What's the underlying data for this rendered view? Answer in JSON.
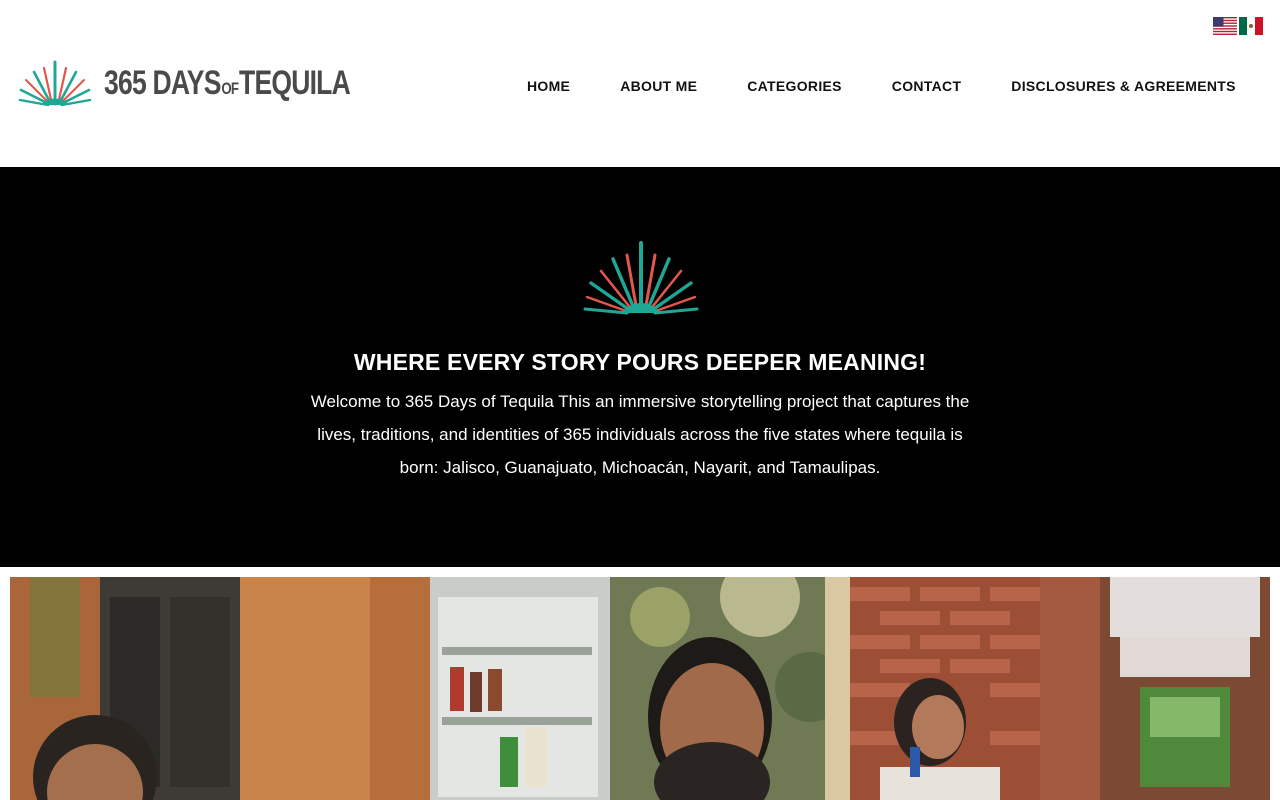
{
  "header": {
    "logo": {
      "text_main": "365 DAYS",
      "text_of": "OF",
      "text_end": "TEQUILA"
    },
    "languages": [
      {
        "code": "en",
        "icon": "us-flag-icon"
      },
      {
        "code": "es",
        "icon": "mexico-flag-icon"
      }
    ],
    "nav": [
      {
        "label": "HOME"
      },
      {
        "label": "ABOUT ME"
      },
      {
        "label": "CATEGORIES"
      },
      {
        "label": "CONTACT"
      },
      {
        "label": "DISCLOSURES & AGREEMENTS"
      }
    ]
  },
  "hero": {
    "icon": "agave-icon",
    "title": "WHERE EVERY STORY POURS DEEPER MEANING!",
    "text": "Welcome to 365 Days of Tequila This an immersive storytelling project that captures the lives, traditions, and identities of 365 individuals across the five states where tequila is born: Jalisco, Guanajuato, Michoacán, Nayarit, and Tamaulipas."
  },
  "colors": {
    "teal": "#1fa795",
    "coral": "#e2574c",
    "logo_gray": "#4a4a4a",
    "hero_bg": "#000000"
  },
  "gallery": [
    {
      "alt": "portrait-woman-orange-wall"
    },
    {
      "alt": "portrait-bearded-man-shop"
    },
    {
      "alt": "portrait-woman-brick-wall-papel-picado"
    }
  ]
}
